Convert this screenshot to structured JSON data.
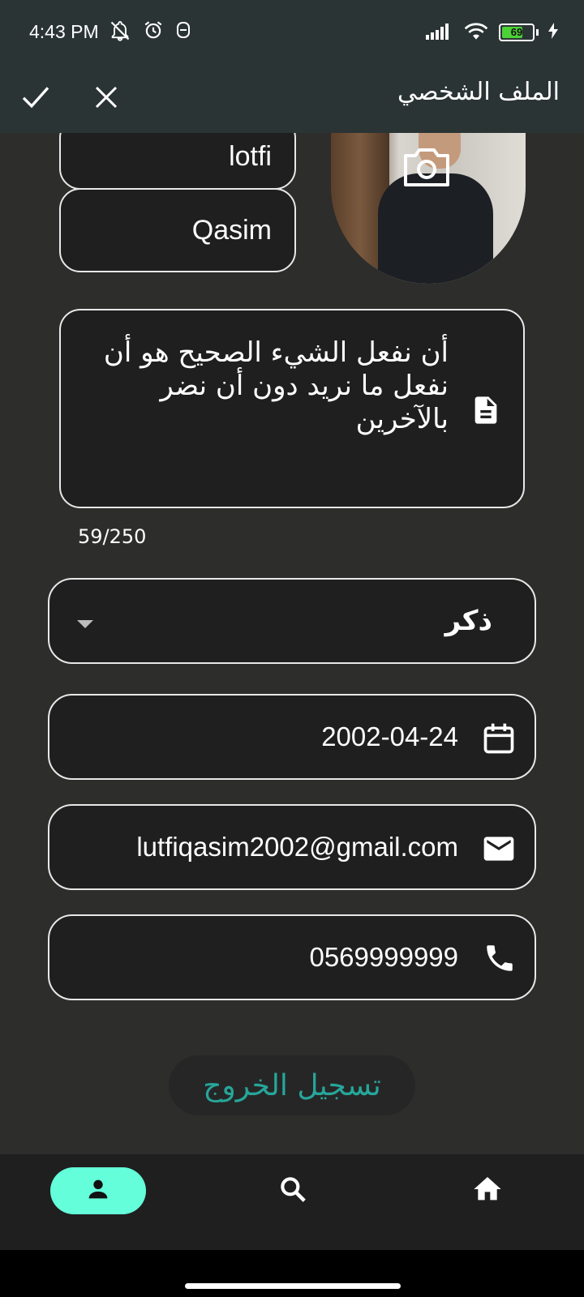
{
  "status_bar": {
    "time": "4:43 PM",
    "battery_level": "69",
    "icons": [
      "mute-notifications-icon",
      "alarm-icon",
      "data-saver-icon",
      "signal-icon",
      "wifi-icon",
      "battery-icon",
      "charging-icon"
    ]
  },
  "app_bar": {
    "title": "الملف الشخصي",
    "confirm_icon": "check-icon",
    "cancel_icon": "close-icon"
  },
  "profile": {
    "first_name": "lotfi",
    "last_name": "Qasim",
    "avatar_action_icon": "camera-icon",
    "bio": "أن نفعل الشيء الصحيح هو أن نفعل ما نريد دون أن نضر بالآخرين",
    "bio_icon": "document-icon",
    "bio_counter": "59/250",
    "gender": "ذكر",
    "birth_date": "2002-04-24",
    "email": "lutfiqasim2002@gmail.com",
    "phone": "0569999999"
  },
  "actions": {
    "logout_label": "تسجيل الخروج"
  },
  "bottom_nav": {
    "items": [
      {
        "icon": "person-icon",
        "active": true
      },
      {
        "icon": "search-icon",
        "active": false
      },
      {
        "icon": "home-icon",
        "active": false
      }
    ]
  },
  "colors": {
    "background": "#2d2d2b",
    "app_bar": "#2b3434",
    "field_background": "#1f1f1f",
    "accent": "#64ffda",
    "logout_text": "#26a69a"
  }
}
